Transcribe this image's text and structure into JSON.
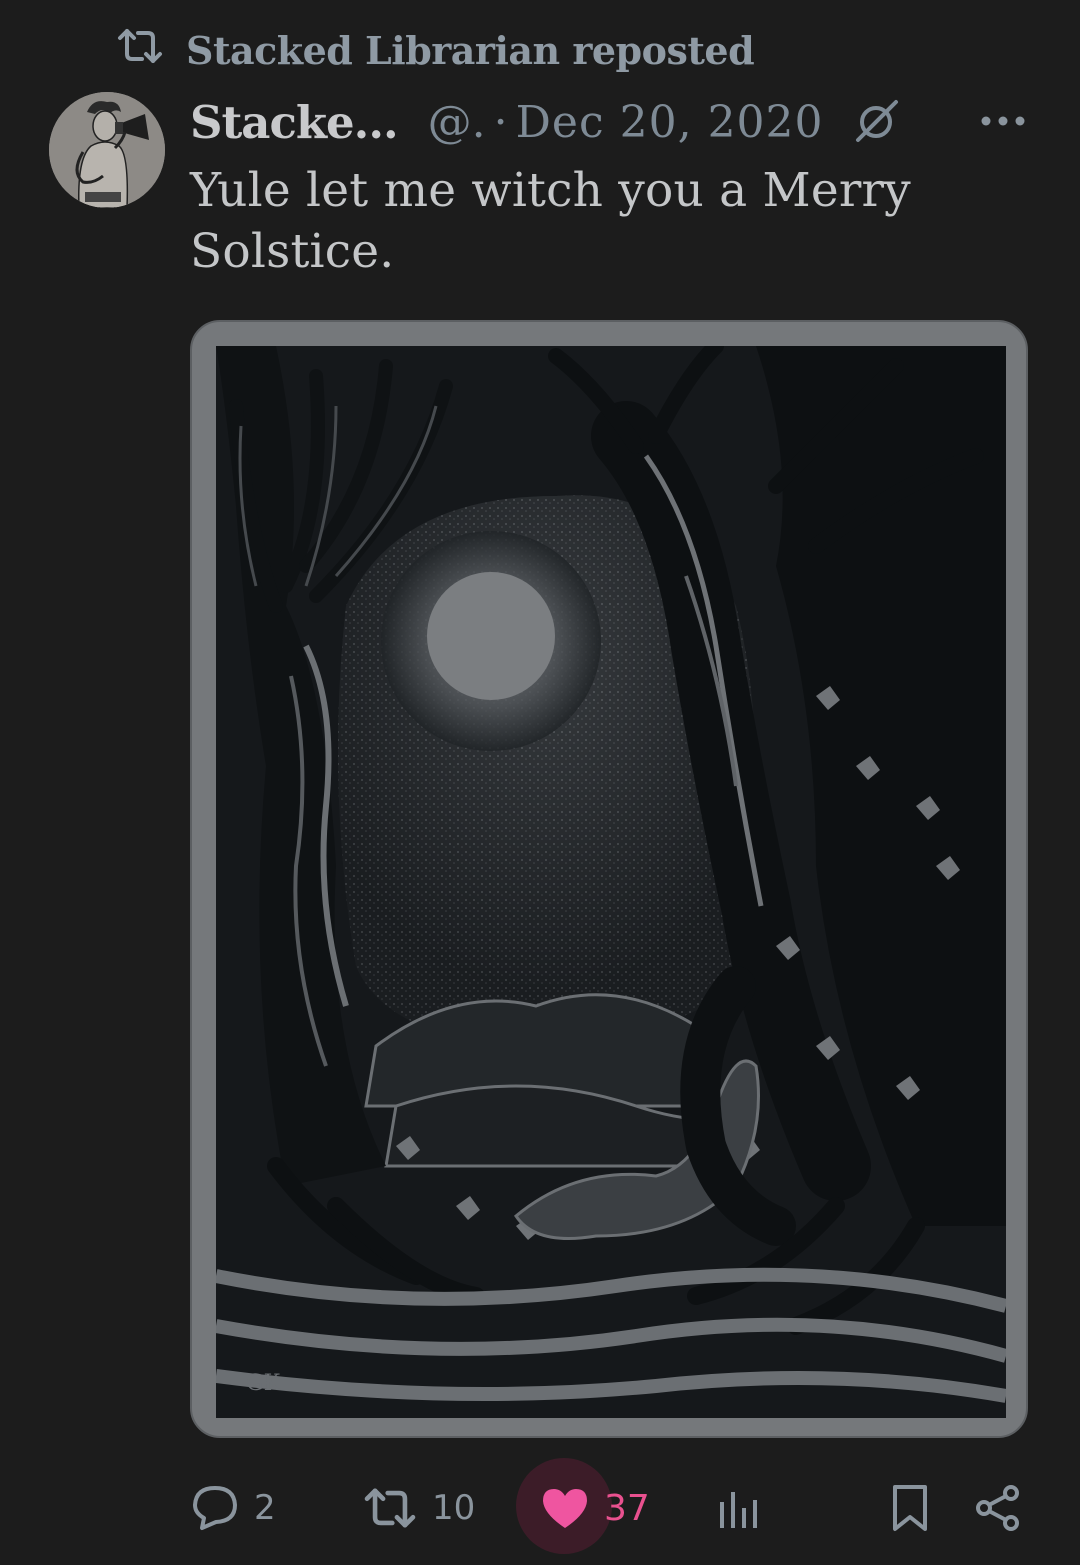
{
  "repost": {
    "label": "Stacked Librarian reposted",
    "icon": "repost-icon"
  },
  "post": {
    "display_name": "Stacke...",
    "handle": "@.",
    "separator": "·",
    "date": "Dec 20, 2020",
    "text_line1": "Yule let me witch you a Merry",
    "text_line2": "Solstice.",
    "media_alt_signature": "GK 2000",
    "media": {
      "depicts": [
        "two trees shaped like women",
        "full moon",
        "hills and roots"
      ]
    }
  },
  "actions": {
    "replies": "2",
    "reposts": "10",
    "likes": "37",
    "liked": true
  },
  "colors": {
    "background": "#1c1c1c",
    "like_accent": "#ef55a0",
    "muted_text": "#7e8a95"
  }
}
